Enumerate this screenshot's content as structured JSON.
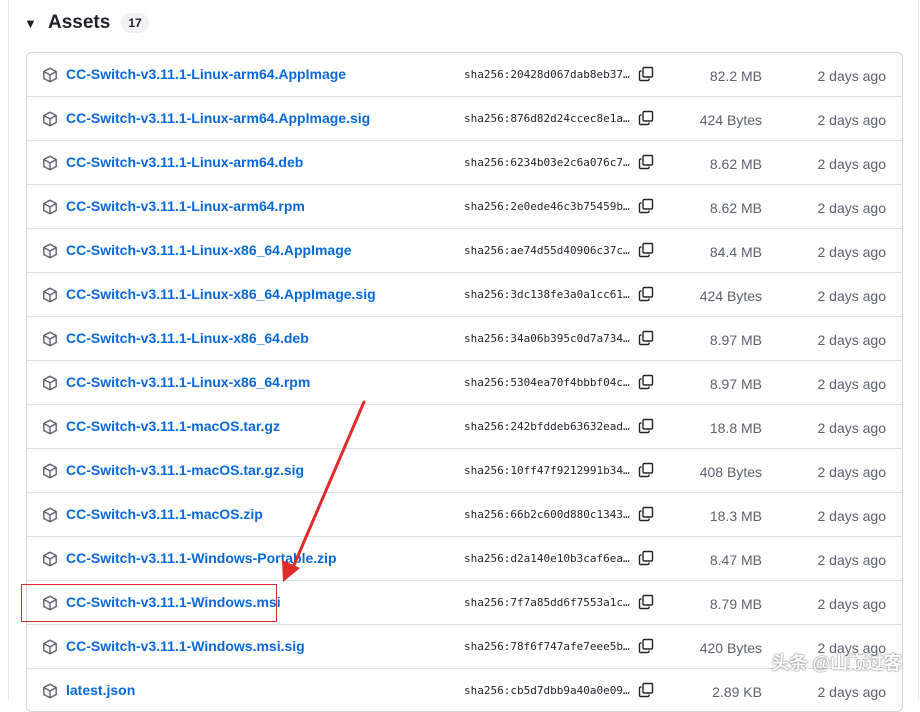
{
  "header": {
    "title": "Assets",
    "count": "17",
    "caret": "▼"
  },
  "assets": [
    {
      "name": "CC-Switch-v3.11.1-Linux-arm64.AppImage",
      "sha": "sha256:20428d067dab8eb37…",
      "size": "82.2 MB",
      "date": "2 days ago"
    },
    {
      "name": "CC-Switch-v3.11.1-Linux-arm64.AppImage.sig",
      "sha": "sha256:876d82d24ccec8e1a…",
      "size": "424 Bytes",
      "date": "2 days ago"
    },
    {
      "name": "CC-Switch-v3.11.1-Linux-arm64.deb",
      "sha": "sha256:6234b03e2c6a076c7…",
      "size": "8.62 MB",
      "date": "2 days ago"
    },
    {
      "name": "CC-Switch-v3.11.1-Linux-arm64.rpm",
      "sha": "sha256:2e0ede46c3b75459b…",
      "size": "8.62 MB",
      "date": "2 days ago"
    },
    {
      "name": "CC-Switch-v3.11.1-Linux-x86_64.AppImage",
      "sha": "sha256:ae74d55d40906c37c…",
      "size": "84.4 MB",
      "date": "2 days ago"
    },
    {
      "name": "CC-Switch-v3.11.1-Linux-x86_64.AppImage.sig",
      "sha": "sha256:3dc138fe3a0a1cc61…",
      "size": "424 Bytes",
      "date": "2 days ago"
    },
    {
      "name": "CC-Switch-v3.11.1-Linux-x86_64.deb",
      "sha": "sha256:34a06b395c0d7a734…",
      "size": "8.97 MB",
      "date": "2 days ago"
    },
    {
      "name": "CC-Switch-v3.11.1-Linux-x86_64.rpm",
      "sha": "sha256:5304ea70f4bbbf04c…",
      "size": "8.97 MB",
      "date": "2 days ago"
    },
    {
      "name": "CC-Switch-v3.11.1-macOS.tar.gz",
      "sha": "sha256:242bfddeb63632ead…",
      "size": "18.8 MB",
      "date": "2 days ago"
    },
    {
      "name": "CC-Switch-v3.11.1-macOS.tar.gz.sig",
      "sha": "sha256:10ff47f9212991b34…",
      "size": "408 Bytes",
      "date": "2 days ago"
    },
    {
      "name": "CC-Switch-v3.11.1-macOS.zip",
      "sha": "sha256:66b2c600d880c1343…",
      "size": "18.3 MB",
      "date": "2 days ago"
    },
    {
      "name": "CC-Switch-v3.11.1-Windows-Portable.zip",
      "sha": "sha256:d2a140e10b3caf6ea…",
      "size": "8.47 MB",
      "date": "2 days ago"
    },
    {
      "name": "CC-Switch-v3.11.1-Windows.msi",
      "sha": "sha256:7f7a85dd6f7553a1c…",
      "size": "8.79 MB",
      "date": "2 days ago"
    },
    {
      "name": "CC-Switch-v3.11.1-Windows.msi.sig",
      "sha": "sha256:78f6f747afe7eee5b…",
      "size": "420 Bytes",
      "date": "2 days ago"
    },
    {
      "name": "latest.json",
      "sha": "sha256:cb5d7dbb9a40a0e09…",
      "size": "2.89 KB",
      "date": "2 days ago"
    }
  ],
  "annotation": {
    "color": "#e02b2b"
  },
  "watermark": {
    "text": "头条 @山巅过客"
  },
  "colors": {
    "link": "#0969da",
    "muted": "#59636e",
    "border": "#d0d7de"
  }
}
